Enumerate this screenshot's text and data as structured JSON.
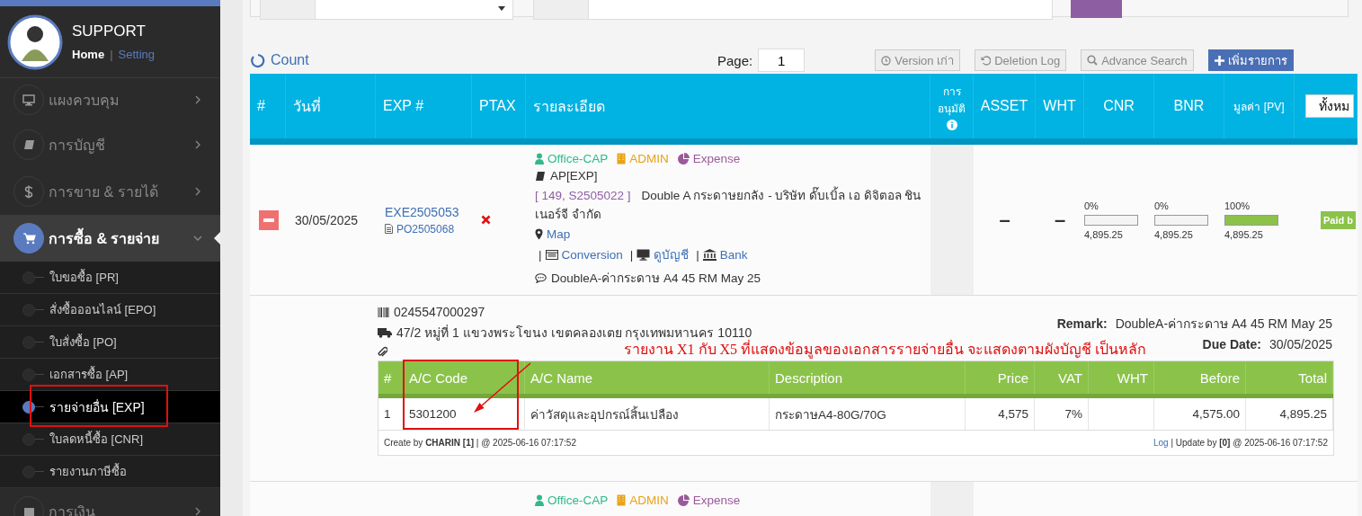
{
  "sidebar": {
    "user": {
      "name": "SUPPORT",
      "home": "Home",
      "divider": "|",
      "setting": "Setting"
    },
    "menu": [
      {
        "label": "แผงควบคุม",
        "expanded": false
      },
      {
        "label": "การบัญชี",
        "expanded": false
      },
      {
        "label": "การขาย & รายได้",
        "expanded": false
      },
      {
        "label": "การซื้อ & รายจ่าย",
        "expanded": true,
        "children": [
          {
            "label": "ใบขอซื้อ [PR]",
            "selected": false
          },
          {
            "label": "สั่งซื้อออนไลน์ [EPO]",
            "selected": false
          },
          {
            "label": "ใบสั่งซื้อ [PO]",
            "selected": false
          },
          {
            "label": "เอกสารซื้อ [AP]",
            "selected": false
          },
          {
            "label": "รายจ่ายอื่น [EXP]",
            "selected": true
          },
          {
            "label": "ใบลดหนี้ซื้อ [CNR]",
            "selected": false
          },
          {
            "label": "รายงานภาษีซื้อ",
            "selected": false
          }
        ]
      },
      {
        "label": "การเงิน",
        "expanded": false
      }
    ]
  },
  "toolbar": {
    "count": "Count",
    "page_label": "Page:",
    "page": "1",
    "buttons": [
      {
        "label": "Version เก่า",
        "kind": "default"
      },
      {
        "label": "Deletion Log",
        "kind": "default"
      },
      {
        "label": "Advance Search",
        "kind": "default"
      },
      {
        "label": "เพิ่มรายการ",
        "kind": "primary"
      }
    ]
  },
  "table": {
    "columns": [
      "#",
      "วันที่",
      "EXP #",
      "PTAX",
      "รายละเอียด",
      "การ อนุมัติ",
      "ASSET",
      "WHT",
      "CNR",
      "BNR",
      "มูลค่า [PV]"
    ],
    "filter_select": "ทั้งหม",
    "rows": [
      {
        "expanded": true,
        "date": "30/05/2025",
        "exp_no": "EXE2505053",
        "po_no": "PO2505068",
        "ptax": false,
        "tags": [
          {
            "text": "Office-CAP",
            "color": "#2fb98e"
          },
          {
            "text": "ADMIN",
            "color": "#e8a317"
          },
          {
            "text": "Expense",
            "color": "#9a5a9a"
          }
        ],
        "doc_type": "AP[EXP]",
        "ref": "[ 149, S2505022 ]",
        "vendor": "Double A กระดาษยกลัง - บริษัท ดั๊บเบิ้ล เอ ดิจิตอล ชินเนอร์จี จำกัด",
        "map": "Map",
        "links": [
          {
            "sep": "|",
            "text": "Conversion"
          },
          {
            "sep": "|",
            "text": "ดูบัญชี"
          },
          {
            "sep": "|",
            "text": "Bank"
          }
        ],
        "note": "DoubleA-ค่ากระดาษ A4 45 RM May 25",
        "asset": "–",
        "wht": "–",
        "meters": [
          {
            "percent": "0%",
            "level": 0,
            "amount": "4,895.25"
          },
          {
            "percent": "0%",
            "level": 0,
            "amount": "4,895.25"
          },
          {
            "percent": "100%",
            "level": 1,
            "amount": "4,895.25"
          }
        ],
        "status": "Paid b",
        "detail": {
          "tax_id": "0245547000297",
          "address": "47/2 หมู่ที่ 1 แขวงพระโขนง เขตคลองเตย กรุงเทพมหานคร 10110",
          "remark_label": "Remark:",
          "remark": "DoubleA-ค่ากระดาษ A4 45 RM May 25",
          "due_label": "Due Date:",
          "due": "30/05/2025",
          "columns": [
            "#",
            "A/C Code",
            "A/C Name",
            "Description",
            "Price",
            "VAT",
            "WHT",
            "Before",
            "Total"
          ],
          "lines": [
            {
              "no": "1",
              "ac_code": "5301200",
              "ac_name": "ค่าวัสดุและอุปกรณ์สิ้นเปลือง",
              "description": "กระดาษA4-80G/70G",
              "price": "4,575",
              "vat": "7%",
              "before": "4,575.00",
              "total": "4,895.25"
            }
          ],
          "created": "Create by **CHARIN [1]** | @ 2025-06-16 07:17:52",
          "log": "Log",
          "updated": "| Update by **[0]** @ 2025-06-16 07:17:52"
        }
      },
      {
        "expanded": false,
        "tags": [
          {
            "text": "Office-CAP",
            "color": "#2fb98e"
          },
          {
            "text": "ADMIN",
            "color": "#e8a317"
          },
          {
            "text": "Expense",
            "color": "#9a5a9a"
          }
        ]
      }
    ]
  },
  "annotation": {
    "note": "รายงาน X1 กับ X5 ที่แสดงข้อมูลของเอกสารรายจ่ายอื่น จะแสดงตามผังบัญชี เป็นหลัก"
  }
}
